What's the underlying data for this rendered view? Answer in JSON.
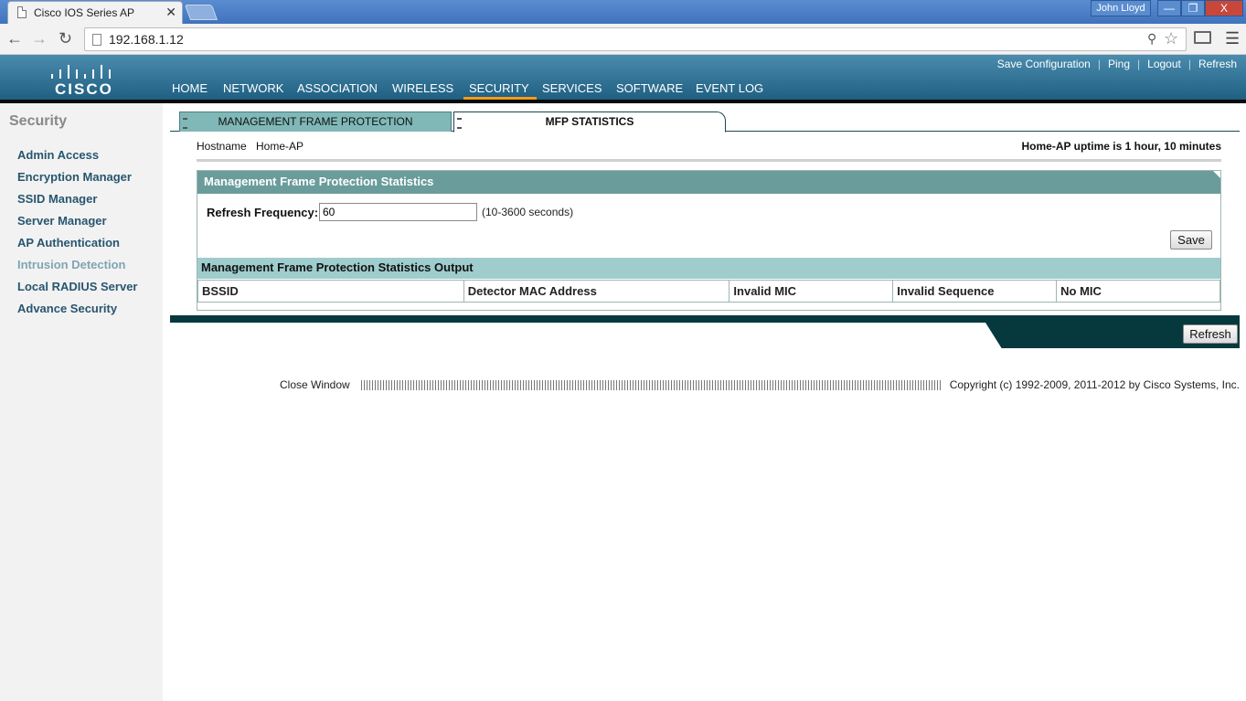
{
  "browser": {
    "tab_title": "Cisco IOS Series AP",
    "tab_close": "✕",
    "user": "John Lloyd",
    "url": "192.168.1.12",
    "win_min": "—",
    "win_max": "❐",
    "win_close": "X"
  },
  "header": {
    "logo_text": "CISCO",
    "top_links": [
      "Save Configuration",
      "Ping",
      "Logout",
      "Refresh"
    ],
    "nav": [
      "HOME",
      "NETWORK",
      "ASSOCIATION",
      "WIRELESS",
      "SECURITY",
      "SERVICES",
      "SOFTWARE",
      "EVENT LOG"
    ],
    "active_nav": "SECURITY",
    "accent_color": "#f39c1a"
  },
  "sidebar": {
    "title": "Security",
    "items": [
      "Admin Access",
      "Encryption Manager",
      "SSID Manager",
      "Server Manager",
      "AP Authentication",
      "Intrusion Detection",
      "Local RADIUS Server",
      "Advance Security"
    ],
    "current": "Intrusion Detection"
  },
  "tabs": {
    "mfp": "MANAGEMENT FRAME PROTECTION",
    "stats": "MFP STATISTICS"
  },
  "host": {
    "label": "Hostname",
    "value": "Home-AP",
    "uptime": "Home-AP uptime is 1 hour, 10 minutes"
  },
  "panel": {
    "title": "Management Frame Protection Statistics",
    "refresh_label": "Refresh Frequency:",
    "refresh_value": "60",
    "refresh_note": "(10-3600 seconds)",
    "save_label": "Save",
    "output_title": "Management Frame Protection Statistics Output",
    "columns": [
      "BSSID",
      "Detector MAC Address",
      "Invalid MIC",
      "Invalid Sequence",
      "No MIC"
    ]
  },
  "footer": {
    "refresh_label": "Refresh",
    "close_window": "Close Window",
    "copyright": "Copyright (c) 1992-2009, 2011-2012 by Cisco Systems, Inc."
  }
}
